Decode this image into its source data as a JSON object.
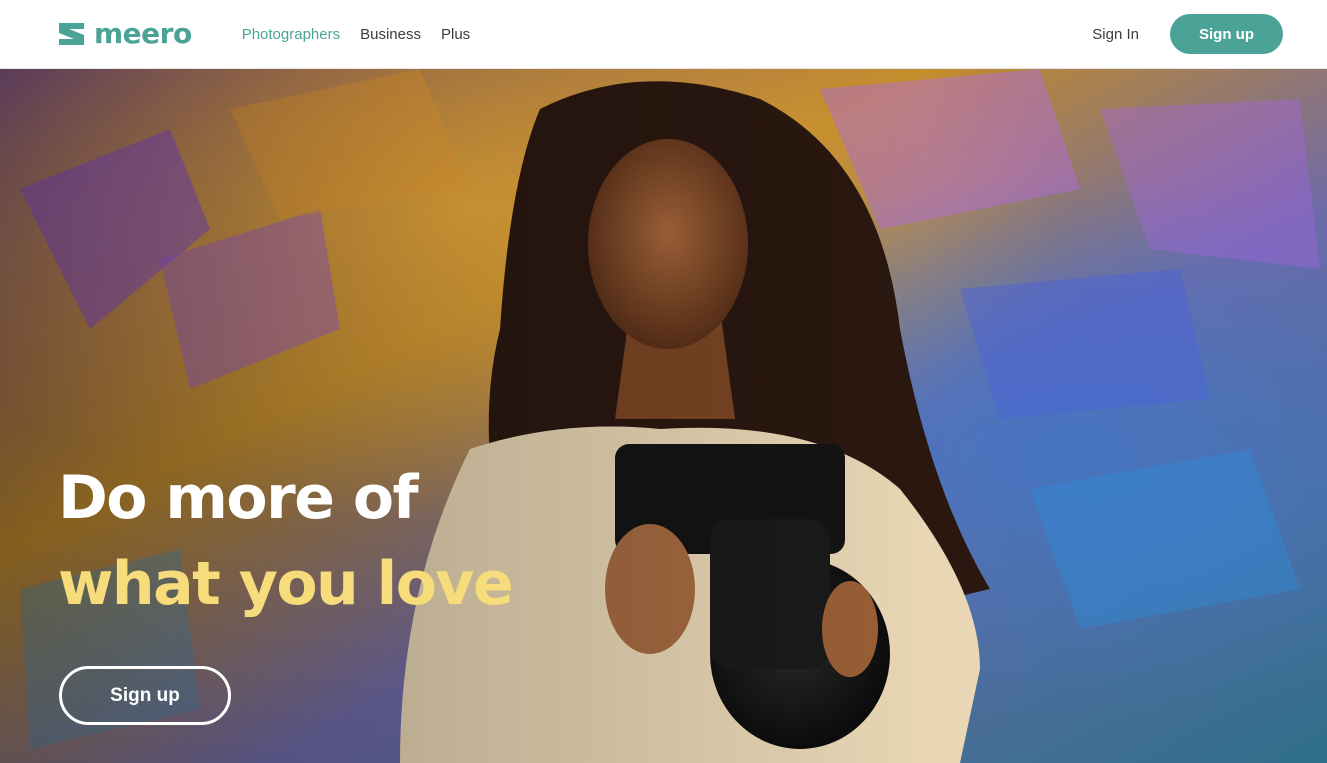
{
  "brand": {
    "name": "meero",
    "color": "#4ba398",
    "logo_icon": "meero-z-logo-icon"
  },
  "nav": {
    "links": [
      {
        "label": "Photographers",
        "active": true
      },
      {
        "label": "Business",
        "active": false
      },
      {
        "label": "Plus",
        "active": false
      }
    ],
    "sign_in": "Sign In",
    "sign_up": "Sign up"
  },
  "hero": {
    "headline_line1": "Do more of",
    "headline_line2": "what you love",
    "headline_line2_color": "#f7dc7c",
    "cta": "Sign up",
    "photo": "woman-holding-sony-camera-colorful-projection-background"
  },
  "colors": {
    "accent": "#4ba398",
    "text_dark": "#3d3d3d",
    "white": "#ffffff"
  }
}
